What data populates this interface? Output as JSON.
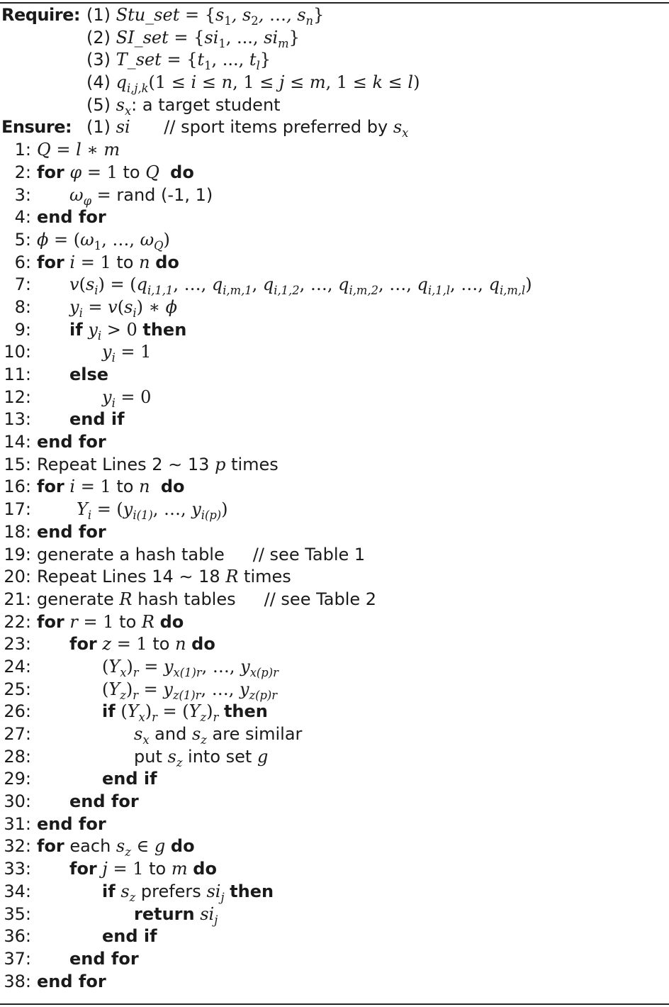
{
  "algorithm": {
    "require_label": "Require:",
    "ensure_label": "Ensure:",
    "require": [
      {
        "num": "(1)",
        "text": "Stu_set = {s1, s2, …, sn}"
      },
      {
        "num": "(2)",
        "text": "SI_set = {si1, ..., sim}"
      },
      {
        "num": "(3)",
        "text": "T_set = {t1, ..., tl}"
      },
      {
        "num": "(4)",
        "text": "qi,j,k(1 ≤ i ≤ n, 1 ≤ j ≤ m, 1 ≤ k ≤ l)"
      },
      {
        "num": "(5)",
        "text": "sx: a target student"
      }
    ],
    "ensure": [
      {
        "num": "(1)",
        "text": "si",
        "comment": "// sport items preferred by sx"
      }
    ],
    "lines": [
      {
        "n": "1:",
        "text": "Q = l ∗ m"
      },
      {
        "n": "2:",
        "text": "for φ = 1 to Q do"
      },
      {
        "n": "3:",
        "text": "ωφ = rand (-1, 1)"
      },
      {
        "n": "4:",
        "text": "end for"
      },
      {
        "n": "5:",
        "text": "ϕ = (ω1, …, ωQ)"
      },
      {
        "n": "6:",
        "text": "for i = 1 to n do"
      },
      {
        "n": "7:",
        "text": "v(si) = (qi,1,1, …, qi,m,1, qi,1,2, …, qi,m,2, …, qi,1,l, …, qi,m,l)"
      },
      {
        "n": "8:",
        "text": "yi = v(si) ∗ ϕ"
      },
      {
        "n": "9:",
        "text": "if yi > 0 then"
      },
      {
        "n": "10:",
        "text": "yi = 1"
      },
      {
        "n": "11:",
        "text": "else"
      },
      {
        "n": "12:",
        "text": "yi = 0"
      },
      {
        "n": "13:",
        "text": "end if"
      },
      {
        "n": "14:",
        "text": "end for"
      },
      {
        "n": "15:",
        "text": "Repeat Lines 2 ∼ 13 p times"
      },
      {
        "n": "16:",
        "text": "for i = 1 to n do"
      },
      {
        "n": "17:",
        "text": "Yi = (yi(1), …, yi(p))"
      },
      {
        "n": "18:",
        "text": "end for"
      },
      {
        "n": "19:",
        "text": "generate a hash table",
        "comment": "// see Table 1"
      },
      {
        "n": "20:",
        "text": "Repeat Lines 14 ∼ 18 R times"
      },
      {
        "n": "21:",
        "text": "generate R hash tables",
        "comment": "// see Table 2"
      },
      {
        "n": "22:",
        "text": "for r = 1 to R do"
      },
      {
        "n": "23:",
        "text": "for z = 1 to n do"
      },
      {
        "n": "24:",
        "text": "(Yx)r = yx(1)r, …, yx(p)r"
      },
      {
        "n": "25:",
        "text": "(Yz)r = yz(1)r, …, yz(p)r"
      },
      {
        "n": "26:",
        "text": "if (Yx)r = (Yz)r then"
      },
      {
        "n": "27:",
        "text": "sx and sz are similar"
      },
      {
        "n": "28:",
        "text": "put sz into set g"
      },
      {
        "n": "29:",
        "text": "end if"
      },
      {
        "n": "30:",
        "text": "end for"
      },
      {
        "n": "31:",
        "text": "end for"
      },
      {
        "n": "32:",
        "text": "for each sz ∈ g do"
      },
      {
        "n": "33:",
        "text": "for j = 1 to m do"
      },
      {
        "n": "34:",
        "text": "if sz prefers sij then"
      },
      {
        "n": "35:",
        "text": "return sij"
      },
      {
        "n": "36:",
        "text": "end if"
      },
      {
        "n": "37:",
        "text": "end for"
      },
      {
        "n": "38:",
        "text": "end for"
      }
    ]
  }
}
